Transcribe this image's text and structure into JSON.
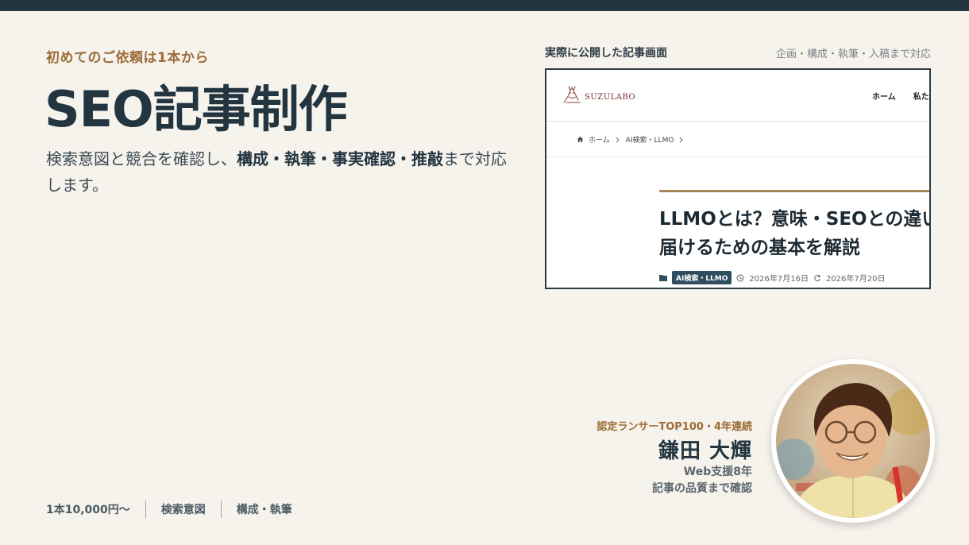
{
  "hero": {
    "eyebrow": "初めてのご依頼は1本から",
    "title": "SEO記事制作",
    "desc_pre": "検索意図と競合を確認し、",
    "desc_bold": "構成・執筆・事実確認・推敲",
    "desc_post": "まで対応します。"
  },
  "screenshot": {
    "label": "実際に公開した記事画面",
    "note": "企画・構成・執筆・入稿まで対応",
    "site_logo": "SUZULABO",
    "nav": [
      "ホーム",
      "私た"
    ],
    "breadcrumb": [
      "ホーム",
      "AI検索・LLMO"
    ],
    "article_title_line1": "LLMOとは？意味・SEOとの違い",
    "article_title_line2": "届けるための基本を解説",
    "tag": "AI検索・LLMO",
    "published": "2026年7月16日",
    "updated": "2026年7月20日"
  },
  "profile": {
    "badge": "認定ランサーTOP100・4年連続",
    "name": "鎌田 大輝",
    "line1": "Web支援8年",
    "line2": "記事の品質まで確認"
  },
  "footer": {
    "items": [
      "1本10,000円〜",
      "検索意図",
      "構成・執筆"
    ]
  },
  "icons": {
    "home": "home-icon",
    "chevron": "chevron-right-icon",
    "folder": "folder-icon",
    "clock": "clock-icon",
    "refresh": "refresh-icon"
  },
  "colors": {
    "accent": "#9b6d37",
    "navy": "#223540",
    "background": "#f6f2ec",
    "tag": "#2f4e5e"
  }
}
